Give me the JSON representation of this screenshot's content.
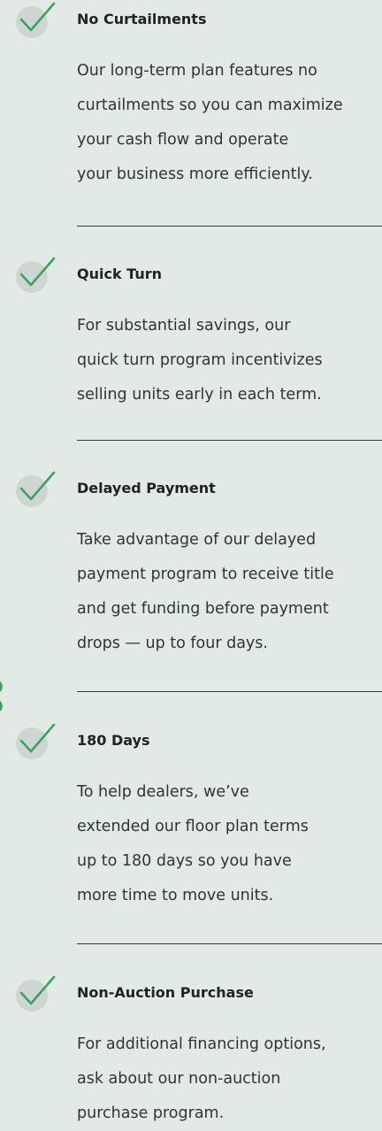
{
  "colors": {
    "background": "#e2eae6",
    "check_accent": "#3aa45c",
    "check_circle": "#cfd6d2",
    "divider": "#3a3a3a"
  },
  "features": [
    {
      "icon": "check-icon",
      "title": "No Curtailments",
      "description_lines": [
        "Our long-term plan features no",
        "curtailments so you can maximize",
        "your cash flow and operate",
        "your business more efficiently."
      ]
    },
    {
      "icon": "check-icon",
      "title": "Quick Turn",
      "description_lines": [
        "For substantial savings, our",
        "quick turn program incentivizes",
        "selling units early in each term."
      ]
    },
    {
      "icon": "check-icon",
      "title": "Delayed Payment",
      "description_lines": [
        "Take advantage of our delayed",
        "payment program to receive title",
        "and get funding before payment",
        "drops — up to four days."
      ]
    },
    {
      "icon": "check-icon",
      "title": "180 Days",
      "description_lines": [
        "To help dealers, we’ve",
        "extended our floor plan terms",
        "up to 180 days so you have",
        "more time to move units."
      ]
    },
    {
      "icon": "check-icon",
      "title": "Non-Auction Purchase",
      "description_lines": [
        "For additional financing options,",
        "ask about our non-auction",
        "purchase program."
      ]
    }
  ]
}
